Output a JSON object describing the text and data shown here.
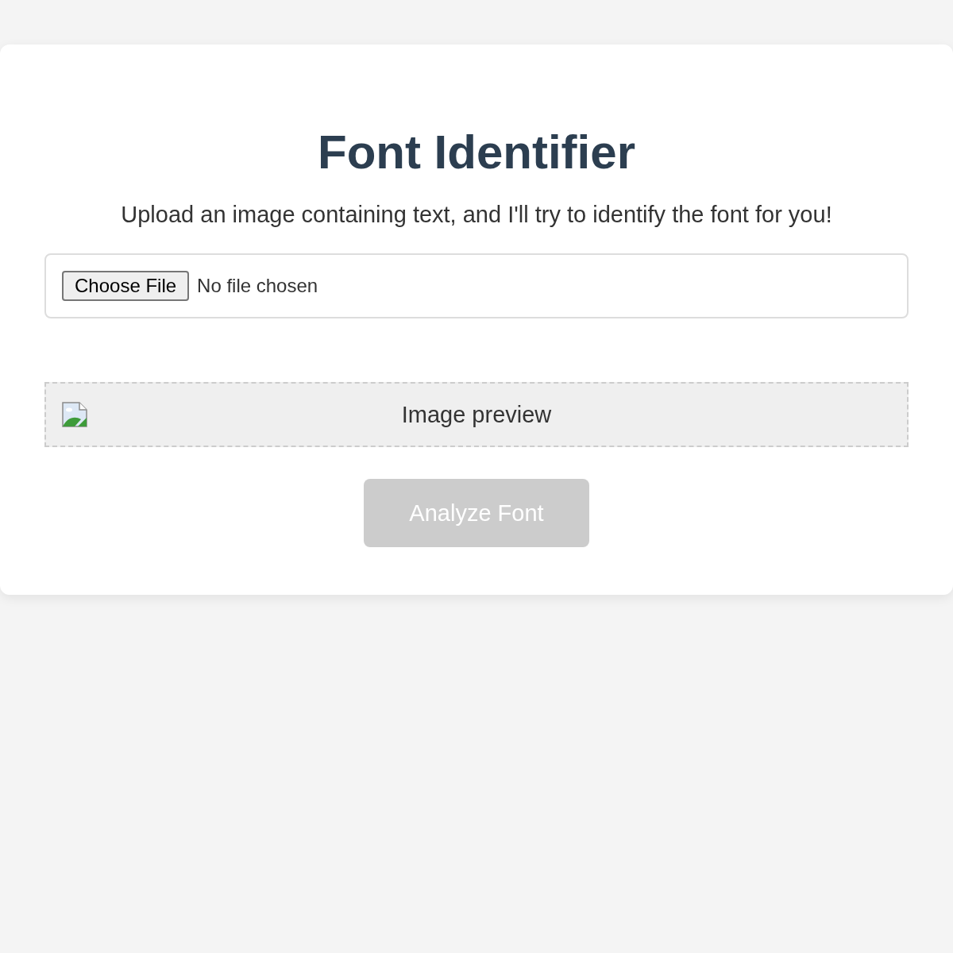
{
  "title": "Font Identifier",
  "subtitle": "Upload an image containing text, and I'll try to identify the font for you!",
  "file_input": {
    "button": "Choose File",
    "status": "No file chosen"
  },
  "preview": {
    "alt_text": "Image preview"
  },
  "analyze_button": {
    "label": "Analyze Font",
    "disabled": true
  }
}
